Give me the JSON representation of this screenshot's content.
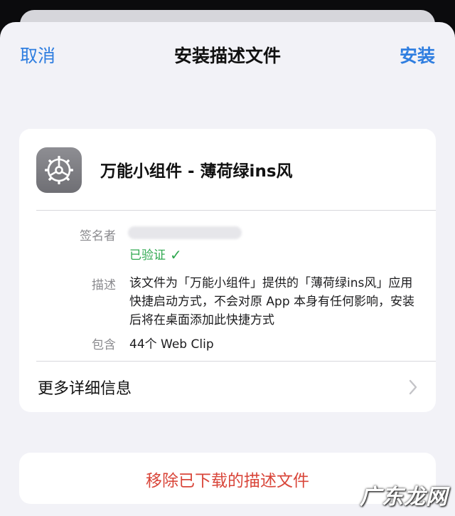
{
  "nav": {
    "cancel_label": "取消",
    "title": "安装描述文件",
    "install_label": "安装"
  },
  "profile": {
    "icon": "gear-icon",
    "name": "万能小组件 - 薄荷绿ins风"
  },
  "details": {
    "signer_label": "签名者",
    "verified_text": "已验证",
    "description_label": "描述",
    "description_text": "该文件为「万能小组件」提供的「薄荷绿ins风」应用快捷启动方式，不会对原 App 本身有任何影响，安装后将在桌面添加此快捷方式",
    "contains_label": "包含",
    "contains_value": "44个 Web Clip"
  },
  "more_details": {
    "label": "更多详细信息",
    "icon": "chevron-right-icon"
  },
  "remove": {
    "label": "移除已下载的描述文件"
  },
  "watermark": {
    "text": "广东龙网"
  },
  "colors": {
    "accent": "#2f7ee0",
    "verified": "#2fa84f",
    "destructive": "#d9463a",
    "background": "#f2f2f7"
  }
}
